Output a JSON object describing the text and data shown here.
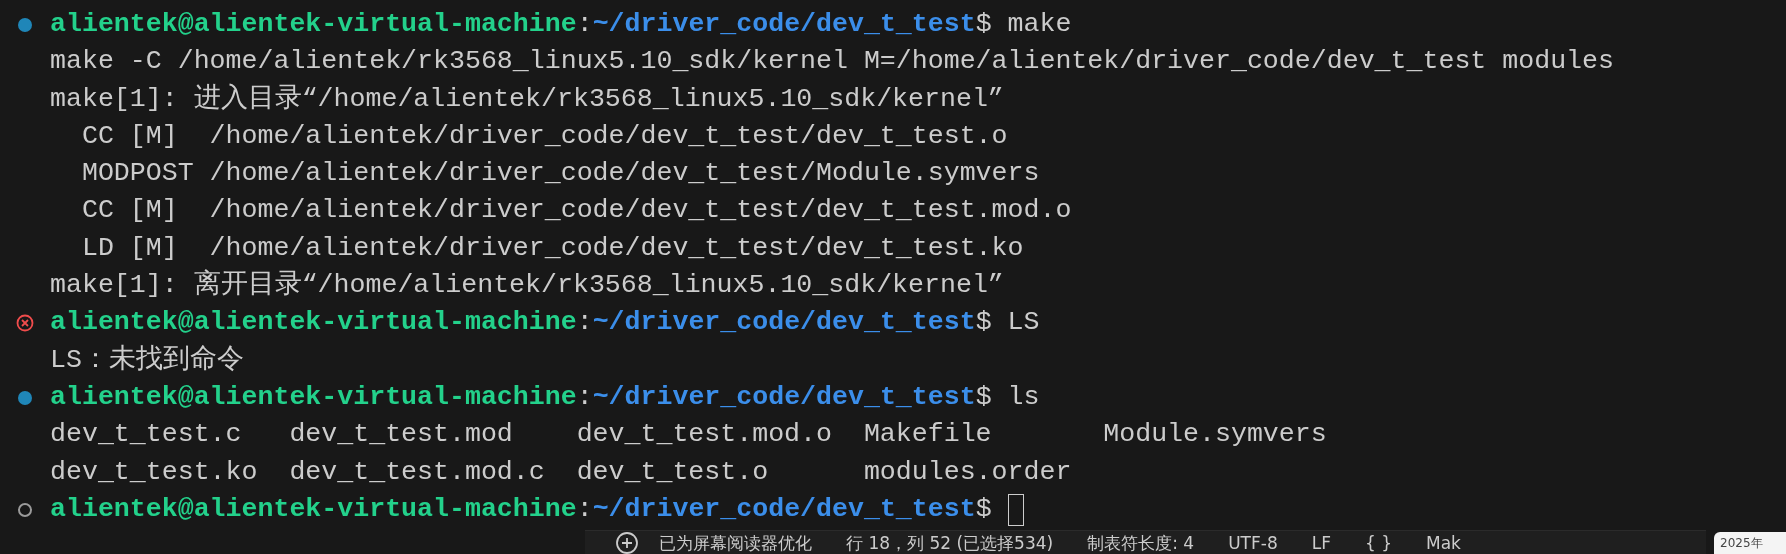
{
  "terminal": {
    "lines": [
      {
        "kind": "prompt",
        "finished": true,
        "failed": false,
        "user": "alientek@alientek-virtual-machine",
        "sep": ":",
        "path": "~/driver_code/dev_t_test",
        "symbol": "$",
        "command": "make"
      },
      {
        "kind": "output",
        "text": "make -C /home/alientek/rk3568_linux5.10_sdk/kernel M=/home/alientek/driver_code/dev_t_test modules"
      },
      {
        "kind": "output",
        "text": "make[1]: 进入目录“/home/alientek/rk3568_linux5.10_sdk/kernel”"
      },
      {
        "kind": "output",
        "text": "  CC [M]  /home/alientek/driver_code/dev_t_test/dev_t_test.o"
      },
      {
        "kind": "output",
        "text": "  MODPOST /home/alientek/driver_code/dev_t_test/Module.symvers"
      },
      {
        "kind": "output",
        "text": "  CC [M]  /home/alientek/driver_code/dev_t_test/dev_t_test.mod.o"
      },
      {
        "kind": "output",
        "text": "  LD [M]  /home/alientek/driver_code/dev_t_test/dev_t_test.ko"
      },
      {
        "kind": "output",
        "text": "make[1]: 离开目录“/home/alientek/rk3568_linux5.10_sdk/kernel”"
      },
      {
        "kind": "prompt",
        "finished": true,
        "failed": true,
        "user": "alientek@alientek-virtual-machine",
        "sep": ":",
        "path": "~/driver_code/dev_t_test",
        "symbol": "$",
        "command": "LS"
      },
      {
        "kind": "output",
        "text": "LS：未找到命令"
      },
      {
        "kind": "prompt",
        "finished": true,
        "failed": false,
        "user": "alientek@alientek-virtual-machine",
        "sep": ":",
        "path": "~/driver_code/dev_t_test",
        "symbol": "$",
        "command": "ls"
      },
      {
        "kind": "listing",
        "items": [
          "dev_t_test.c",
          "dev_t_test.mod",
          "dev_t_test.mod.o",
          "Makefile",
          "Module.symvers"
        ]
      },
      {
        "kind": "listing",
        "items": [
          "dev_t_test.ko",
          "dev_t_test.mod.c",
          "dev_t_test.o",
          "modules.order"
        ]
      },
      {
        "kind": "prompt",
        "finished": false,
        "user": "alientek@alientek-virtual-machine",
        "sep": ":",
        "path": "~/driver_code/dev_t_test",
        "symbol": "$",
        "cursor": true
      }
    ]
  },
  "status_bar": {
    "items": [
      {
        "kind": "icon"
      },
      {
        "kind": "text",
        "text": "已为屏幕阅读器优化"
      },
      {
        "kind": "text",
        "text": "行 18，列 52 (已选择534)"
      },
      {
        "kind": "text",
        "text": "制表符长度: 4"
      },
      {
        "kind": "text",
        "text": "UTF-8"
      },
      {
        "kind": "text",
        "text": "LF"
      },
      {
        "kind": "text",
        "text": "{ }"
      },
      {
        "kind": "text",
        "text": "Mak"
      }
    ],
    "tooltip": "2025年"
  }
}
